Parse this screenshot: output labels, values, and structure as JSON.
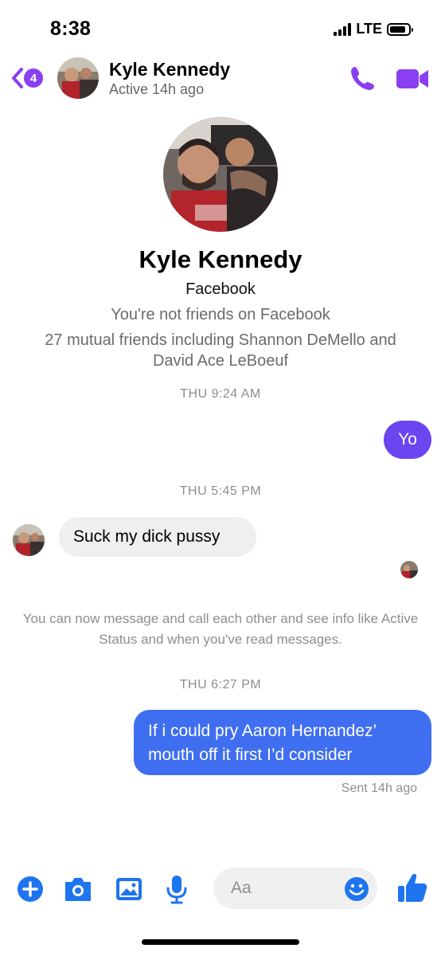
{
  "status_bar": {
    "time": "8:38",
    "network": "LTE",
    "signal_bars": 4,
    "battery_level": 0.85
  },
  "header": {
    "back_badge": "4",
    "name": "Kyle Kennedy",
    "status": "Active 14h ago",
    "accent_color": "#8a3ff0"
  },
  "profile": {
    "name": "Kyle Kennedy",
    "source": "Facebook",
    "friend_status": "You're not friends on Facebook",
    "mutual": "27 mutual friends including Shannon DeMello and David Ace LeBoeuf"
  },
  "conversation": {
    "ts1": "THU 9:24 AM",
    "msg1": "Yo",
    "ts2": "THU 5:45 PM",
    "msg2": "Suck my dick pussy",
    "system_note": "You can now message and call each other and see info like Active Status and when you've read messages.",
    "ts3": "THU 6:27 PM",
    "msg3": "If i could pry Aaron Hernandez’ mouth off it first I’d consider",
    "sent": "Sent 14h ago"
  },
  "composer": {
    "placeholder": "Aa",
    "tools": [
      "plus-icon",
      "camera-icon",
      "image-icon",
      "microphone-icon",
      "emoji-icon",
      "thumbs-up-icon"
    ],
    "tool_color": "#1f74f0"
  }
}
